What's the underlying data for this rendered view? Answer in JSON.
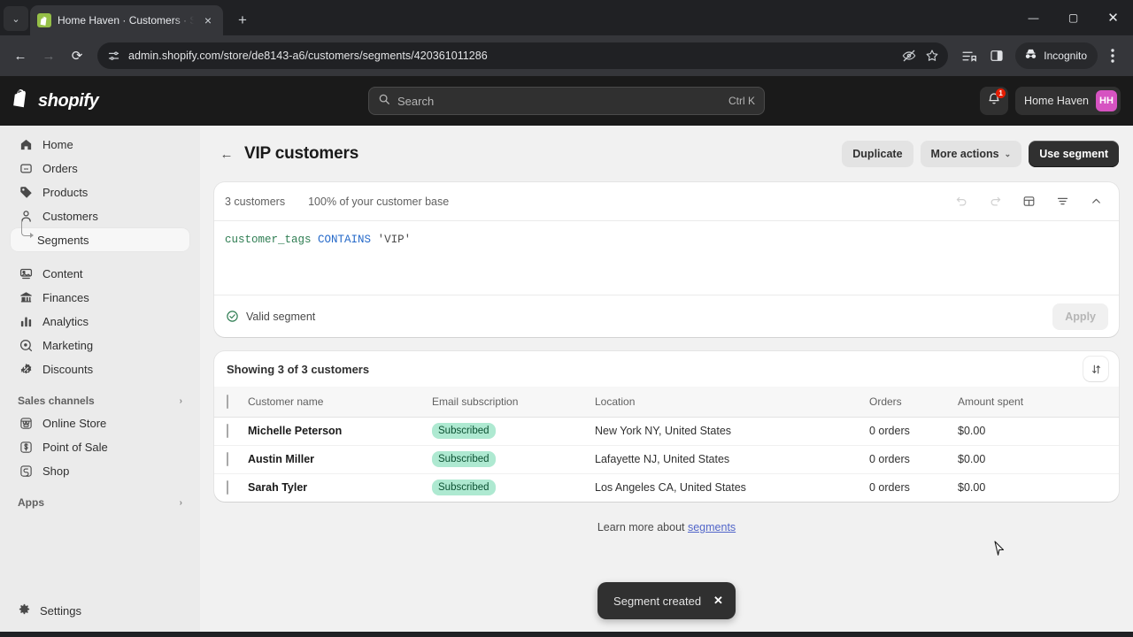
{
  "browser": {
    "tab": {
      "title": "Home Haven · Customers · Sho",
      "favicon": "shopify-icon",
      "close": "×"
    },
    "newtab_label": "+",
    "window_controls": {
      "minimize": "—",
      "maximize": "▢",
      "close": "✕"
    },
    "nav": {
      "back": "←",
      "forward": "→",
      "reload": "⟳"
    },
    "omnibox": {
      "url": "admin.shopify.com/store/de8143-a6/customers/segments/420361011286",
      "site_icon": "page-settings-icon",
      "tracking_icon": "eye-off-icon",
      "bookmark_icon": "star-icon"
    },
    "toolbar_right": {
      "reading_list_icon": "reading-list-icon",
      "side_panel_icon": "side-panel-icon",
      "incognito_label": "Incognito",
      "incognito_icon": "incognito-icon",
      "menu_icon": "kebab-menu-icon"
    }
  },
  "topbar": {
    "brand": "shopify",
    "search": {
      "placeholder": "Search",
      "shortcut": "Ctrl K",
      "icon": "search-icon"
    },
    "notifications": {
      "icon": "bell-icon",
      "count": "1"
    },
    "store": {
      "name": "Home Haven",
      "initials": "HH",
      "avatar_color": "#d653c1"
    }
  },
  "sidebar": {
    "items": [
      {
        "label": "Home",
        "icon": "home-icon"
      },
      {
        "label": "Orders",
        "icon": "orders-icon"
      },
      {
        "label": "Products",
        "icon": "tag-icon"
      },
      {
        "label": "Customers",
        "icon": "person-icon"
      },
      {
        "label": "Segments",
        "icon": "subtree-arrow-icon",
        "active": true,
        "sub": true
      },
      {
        "label": "Content",
        "icon": "content-icon"
      },
      {
        "label": "Finances",
        "icon": "bank-icon"
      },
      {
        "label": "Analytics",
        "icon": "bar-chart-icon"
      },
      {
        "label": "Marketing",
        "icon": "megaphone-icon"
      },
      {
        "label": "Discounts",
        "icon": "discount-icon"
      }
    ],
    "sales_channels": {
      "label": "Sales channels",
      "chevron": "›",
      "items": [
        {
          "label": "Online Store",
          "icon": "storefront-icon"
        },
        {
          "label": "Point of Sale",
          "icon": "pos-icon"
        },
        {
          "label": "Shop",
          "icon": "shop-icon"
        }
      ]
    },
    "apps": {
      "label": "Apps",
      "chevron": "›"
    },
    "settings": {
      "label": "Settings",
      "icon": "gear-icon"
    }
  },
  "page": {
    "back_arrow": "←",
    "title": "VIP customers",
    "actions": {
      "duplicate": "Duplicate",
      "more_actions": "More actions",
      "more_actions_chevron": "⌄",
      "use_segment": "Use segment"
    }
  },
  "segment_card": {
    "customer_count": "3 customers",
    "base_percent": "100% of your customer base",
    "tools": [
      {
        "name": "undo-icon",
        "glyph": "↺",
        "disabled": true
      },
      {
        "name": "redo-icon",
        "glyph": "↻",
        "disabled": true
      },
      {
        "name": "template-icon",
        "glyph": "▤",
        "disabled": false
      },
      {
        "name": "filter-icon",
        "glyph": "≡",
        "disabled": false
      },
      {
        "name": "chevron-up-icon",
        "glyph": "⌃",
        "disabled": false
      }
    ],
    "query": {
      "field": "customer_tags",
      "operator": "CONTAINS",
      "value": "'VIP'"
    },
    "validity": {
      "label": "Valid segment",
      "icon": "check-circle-icon"
    },
    "apply_label": "Apply"
  },
  "customer_list": {
    "showing": "Showing 3 of 3 customers",
    "sort_icon": "sort-icon",
    "columns": [
      "Customer name",
      "Email subscription",
      "Location",
      "Orders",
      "Amount spent"
    ],
    "rows": [
      {
        "name": "Michelle Peterson",
        "email_subscription": "Subscribed",
        "location": "New York NY, United States",
        "orders": "0 orders",
        "amount_spent": "$0.00"
      },
      {
        "name": "Austin Miller",
        "email_subscription": "Subscribed",
        "location": "Lafayette NJ, United States",
        "orders": "0 orders",
        "amount_spent": "$0.00"
      },
      {
        "name": "Sarah Tyler",
        "email_subscription": "Subscribed",
        "location": "Los Angeles CA, United States",
        "orders": "0 orders",
        "amount_spent": "$0.00"
      }
    ]
  },
  "footer": {
    "learn_prefix": "Learn more about ",
    "learn_link": "segments"
  },
  "toast": {
    "message": "Segment created",
    "close": "✕"
  },
  "colors": {
    "brand_dark": "#1a1a1a",
    "badge_bg": "#aee9d1",
    "badge_text": "#0c5132",
    "link": "#5266c9",
    "accent_avatar": "#d653c1",
    "valid_green": "#2e7d52"
  }
}
